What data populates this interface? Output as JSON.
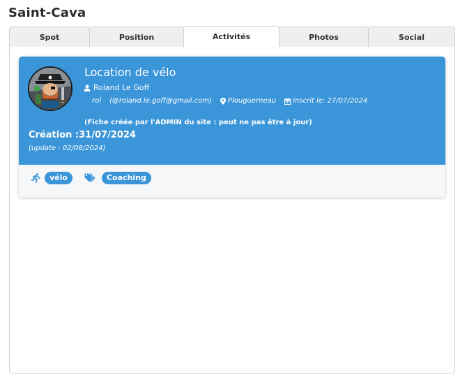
{
  "page": {
    "title": "Saint-Cava"
  },
  "tabs": [
    {
      "label": "Spot",
      "active": false
    },
    {
      "label": "Position",
      "active": false
    },
    {
      "label": "Activités",
      "active": true
    },
    {
      "label": "Photos",
      "active": false
    },
    {
      "label": "Social",
      "active": false
    }
  ],
  "card": {
    "title": "Location de vélo",
    "author": "Roland Le Goff",
    "username": "rol",
    "email": "(@roland.le.goff@gmail.com)",
    "location": "Plouguerneau",
    "registered": "Inscrit le: 27/07/2024",
    "notice": "(Fiche créée par l'ADMIN du site : peut ne pas être à jour)",
    "creation": "Création :31/07/2024",
    "update": "(update : 02/08/2024)",
    "activity_tag": "vélo",
    "category_tag": "Coaching"
  },
  "colors": {
    "accent": "#3a95d9",
    "tabs_bg": "#efefef"
  },
  "icons": [
    "user-icon",
    "map-marker-icon",
    "calendar-icon",
    "running-icon",
    "tags-icon"
  ]
}
